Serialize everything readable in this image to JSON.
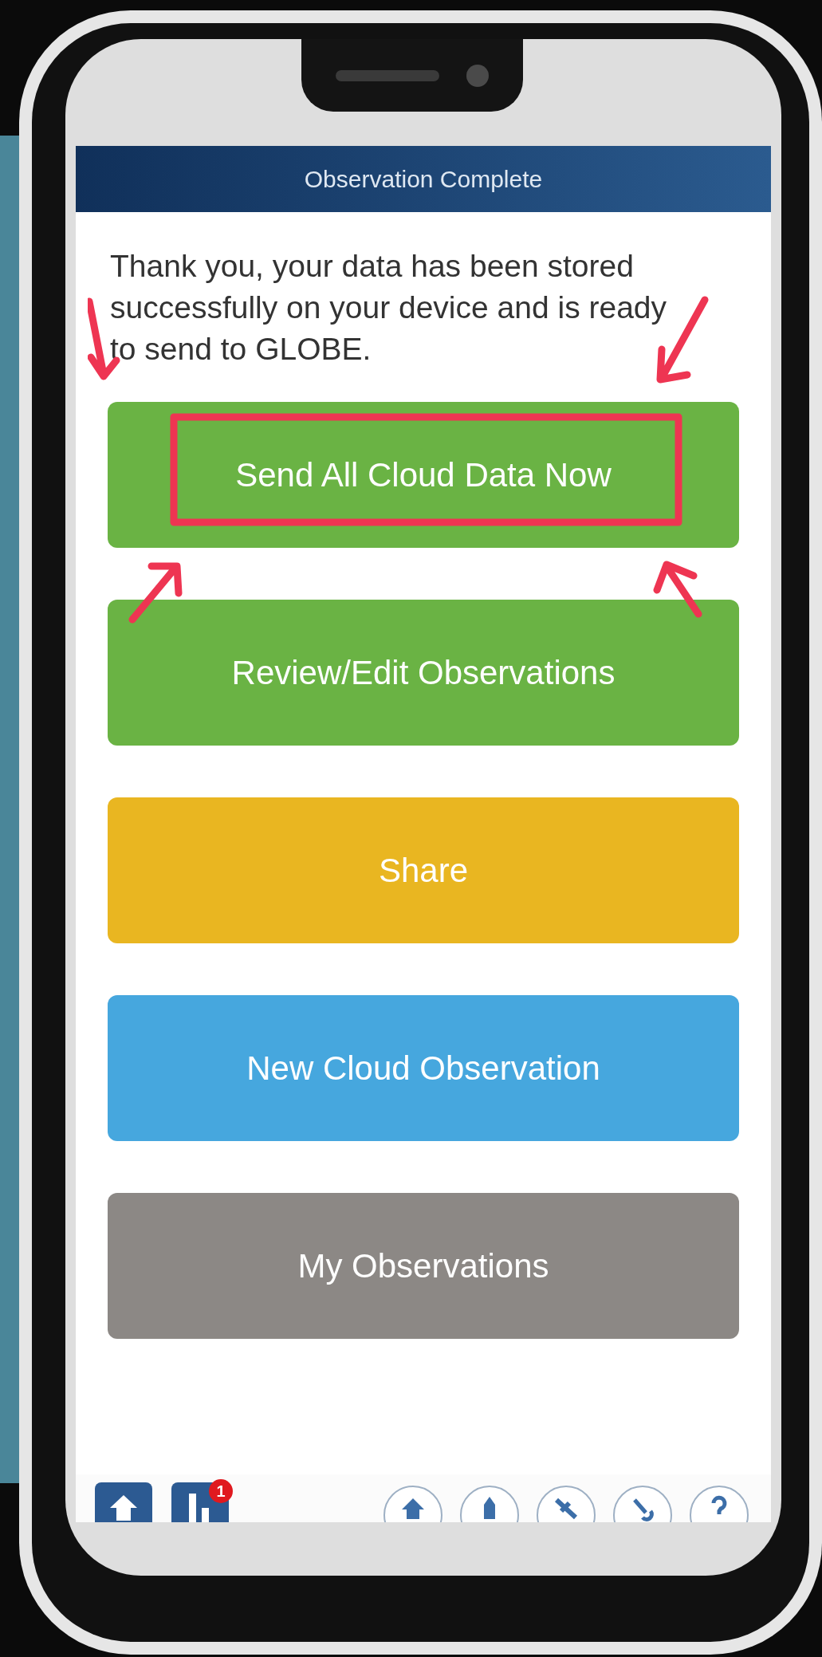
{
  "header": {
    "title": "Observation Complete"
  },
  "message": "Thank you, your data has been stored successfully on your device and is ready to send to GLOBE.",
  "buttons": [
    {
      "label": "Send All Cloud Data Now",
      "color": "#6ab344"
    },
    {
      "label": "Review/Edit Observations",
      "color": "#6ab344"
    },
    {
      "label": "Share",
      "color": "#e9b621"
    },
    {
      "label": "New Cloud Observation",
      "color": "#46a7de"
    },
    {
      "label": "My Observations",
      "color": "#8c8885"
    }
  ],
  "bottom_bar": {
    "badge": "1"
  }
}
